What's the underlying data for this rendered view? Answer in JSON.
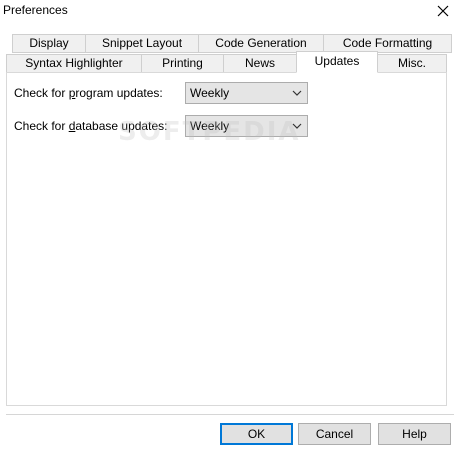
{
  "window": {
    "title": "Preferences",
    "close_icon": "close-icon"
  },
  "tabs": {
    "row1": [
      {
        "label": "Display",
        "selected": false
      },
      {
        "label": "Snippet Layout",
        "selected": false
      },
      {
        "label": "Code Generation",
        "selected": false
      },
      {
        "label": "Code Formatting",
        "selected": false
      }
    ],
    "row2": [
      {
        "label": "Syntax Highlighter",
        "selected": false
      },
      {
        "label": "Printing",
        "selected": false
      },
      {
        "label": "News",
        "selected": false
      },
      {
        "label": "Updates",
        "selected": true
      },
      {
        "label": "Misc.",
        "selected": false
      }
    ]
  },
  "updates": {
    "program": {
      "label": "Check for program updates:",
      "underline_char": "p",
      "value": "Weekly"
    },
    "database": {
      "label": "Check for database updates:",
      "underline_char": "d",
      "value": "Weekly"
    }
  },
  "watermark": "SOFTPEDIA",
  "buttons": {
    "ok": "OK",
    "cancel": "Cancel",
    "help": "Help"
  }
}
